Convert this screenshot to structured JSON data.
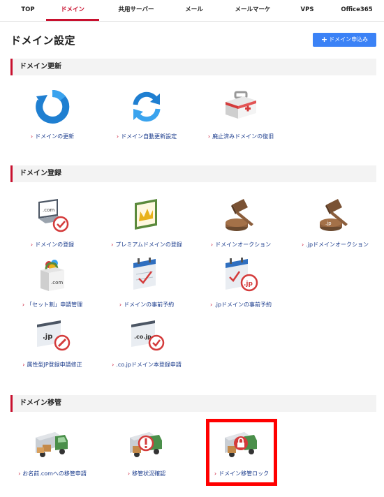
{
  "nav": [
    "TOP",
    "ドメイン",
    "共用サーバー",
    "メール",
    "メールマーケ",
    "VPS",
    "Office365"
  ],
  "page_title": "ドメイン設定",
  "apply_button": "ドメイン申込み",
  "sections": {
    "renewal": {
      "title": "ドメイン更新",
      "items": [
        "ドメインの更新",
        "ドメイン自動更新設定",
        "廃止済みドメインの復旧"
      ]
    },
    "registration": {
      "title": "ドメイン登録",
      "items": [
        "ドメインの登録",
        "プレミアムドメインの登録",
        "ドメインオークション",
        ".jpドメインオークション",
        "「セット割」申請管理",
        "ドメインの事前予約",
        ".jpドメインの事前予約",
        "属性型JP登録申請修正",
        ".co.jpドメイン本登録申請"
      ]
    },
    "transfer": {
      "title": "ドメイン移管",
      "items": [
        "お名前.comへの移管申請",
        "移管状況確認",
        "ドメイン移管ロック"
      ]
    }
  },
  "icon_texts": {
    "com": ".com",
    "jp": ".jp",
    "cojp": ".co.jp"
  },
  "colors": {
    "accent_red": "#c8102e",
    "button_blue": "#3b82f6",
    "link_blue": "#1a3b8c",
    "highlight": "#ff0000"
  }
}
